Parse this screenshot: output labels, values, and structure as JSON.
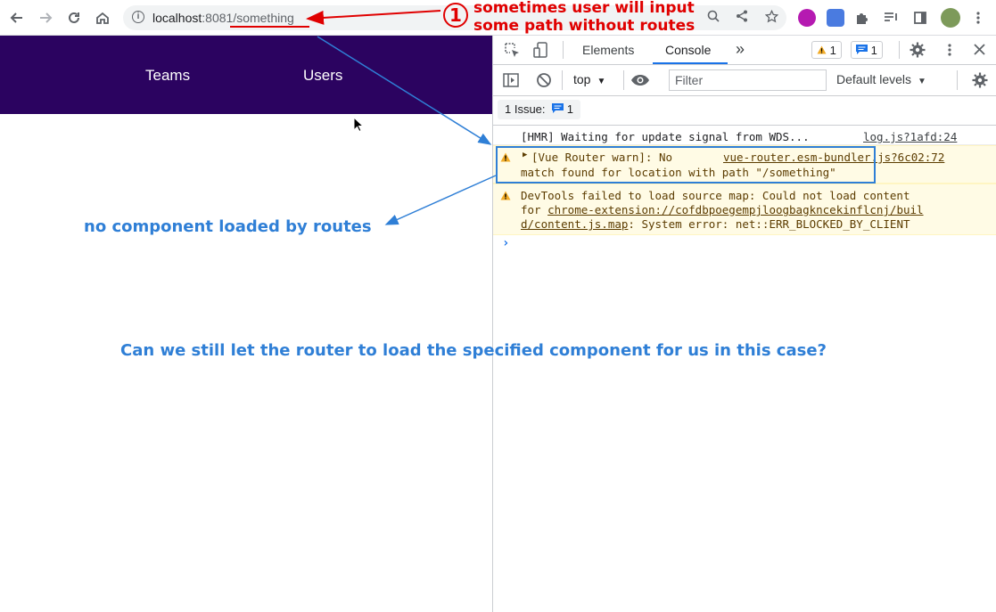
{
  "browser": {
    "url_host": "localhost",
    "url_port": ":8081",
    "url_path": "/something"
  },
  "page": {
    "nav": [
      "Teams",
      "Users"
    ],
    "navbar_color": "#2b0360"
  },
  "devtools": {
    "tabs": [
      "Elements",
      "Console"
    ],
    "more_tabs": "»",
    "warn_count": "1",
    "info_count": "1",
    "context": "top",
    "filter_placeholder": "Filter",
    "levels": "Default levels",
    "issues_label": "1 Issue:",
    "issues_count": "1",
    "messages": [
      {
        "text": "[HMR] Waiting for update signal from WDS...",
        "source": "log.js?1afd:24"
      },
      {
        "text1": "[Vue Router warn]: No",
        "source": "vue-router.esm-bundler.js?6c02:72",
        "text2": "match found for location with path \"/something\""
      },
      {
        "text1": "DevTools failed to load source map: Could not load content",
        "text2a": "for ",
        "link": "chrome-extension://cofdbpoegempjloogbagkncekinflcnj/buil",
        "text3a": "d/content.js.map",
        "text3b": ": System error: net::ERR_BLOCKED_BY_CLIENT"
      }
    ]
  },
  "annotations": {
    "number": "1",
    "red_line1": "sometimes user will input",
    "red_line2": "some path without routes",
    "blue_left": "no component loaded by routes",
    "blue_question": "Can we still let the router to load the specified component for us in this case?",
    "red_color": "#e00000",
    "blue_color": "#2f7fd6"
  }
}
